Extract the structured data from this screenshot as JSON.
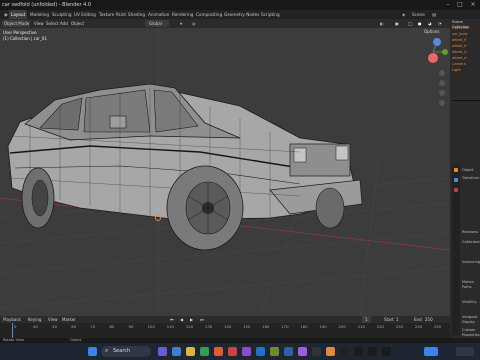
{
  "titlebar": {
    "title": "car sedfold (unfolded) - Blender 4.0"
  },
  "menubar": {
    "tabs": [
      "Layout",
      "Modeling",
      "Sculpting",
      "UV Editing",
      "Texture Paint",
      "Shading",
      "Animation",
      "Rendering",
      "Compositing",
      "Geometry Nodes",
      "Scripting"
    ],
    "scene_label": "Scene"
  },
  "header3d": {
    "object_mode": "Object Mode",
    "view_menu": "View",
    "select_menu": "Select",
    "add_menu": "Add",
    "object_menu": "Object",
    "transform": "Global",
    "options": "Options"
  },
  "viewport": {
    "view_label": "User Perspective",
    "collection_label": "(1) Collection | car_01"
  },
  "outliner": {
    "header": "Scene Collection",
    "items": [
      "Collection",
      "car_body",
      "wheel_fl",
      "wheel_fr",
      "wheel_rl",
      "wheel_rr",
      "Camera",
      "Light"
    ]
  },
  "properties": {
    "items": [
      "Object",
      "Transform",
      "Relations",
      "Collections",
      "Instancing",
      "Motion Paths",
      "Visibility",
      "Viewport Display",
      "Custom Properties"
    ]
  },
  "timeline": {
    "playback": "Playback",
    "keying": "Keying",
    "view": "View",
    "marker": "Marker",
    "current_frame": "1",
    "start_label": "Start",
    "start": "1",
    "end_label": "End",
    "end": "250",
    "ticks": [
      "0",
      "40",
      "50",
      "60",
      "70",
      "80",
      "90",
      "100",
      "110",
      "120",
      "130",
      "140",
      "150",
      "160",
      "170",
      "180",
      "190",
      "200",
      "210",
      "220",
      "230",
      "240",
      "250"
    ]
  },
  "statusbar": {
    "left": "Rotate View",
    "mid": "Object"
  },
  "taskbar": {
    "search_placeholder": "Search"
  },
  "colors": {
    "accent": "#e8883a",
    "viewport_bg": "#3c3c3c",
    "wire": "#1a1a1a"
  }
}
